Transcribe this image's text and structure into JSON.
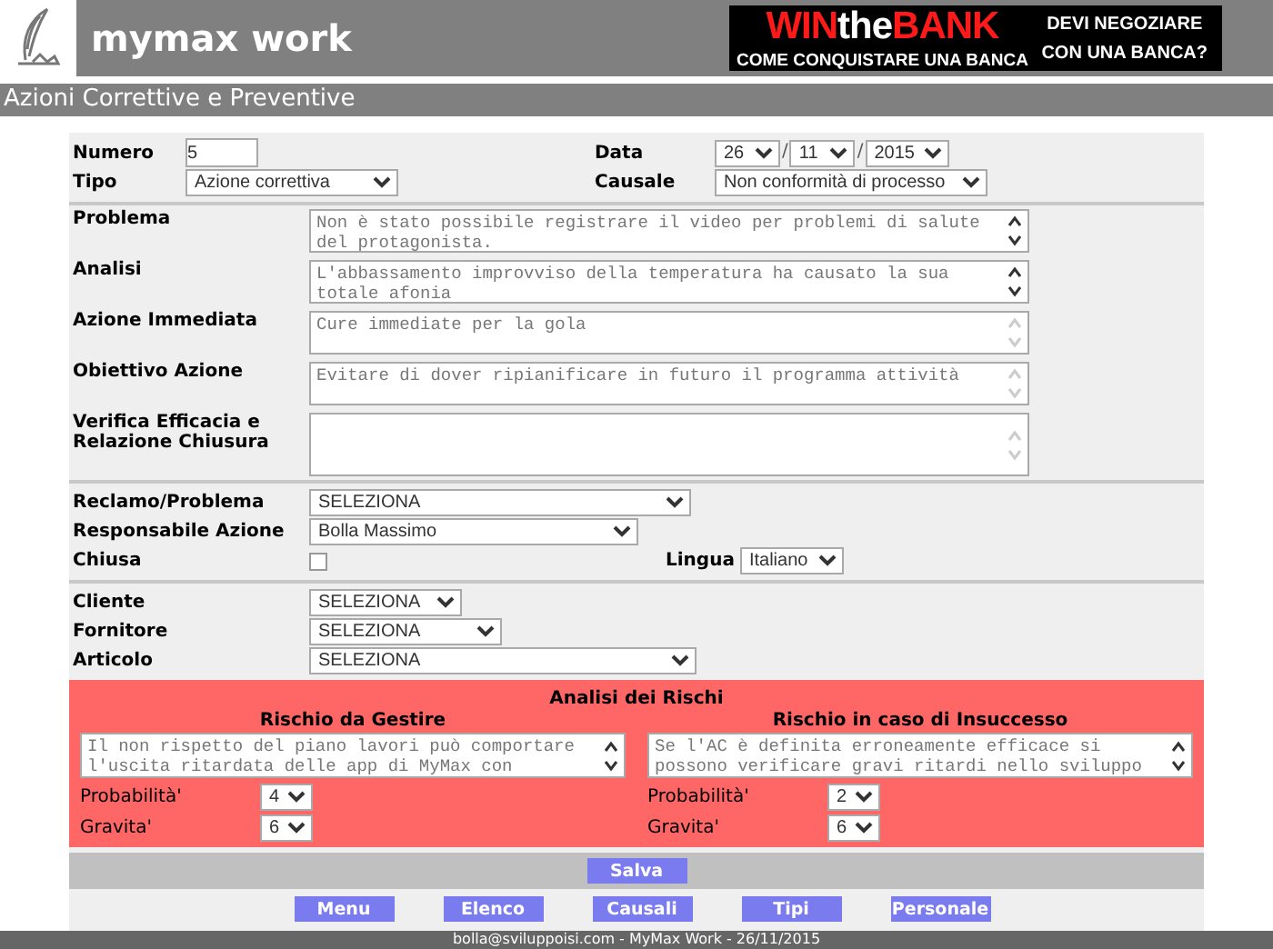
{
  "header": {
    "app_name": "mymax work",
    "banner": {
      "headline": [
        {
          "text": "WIN",
          "color": "#ff1a1a"
        },
        {
          "text": "the",
          "color": "#ffffff"
        },
        {
          "text": "BANK",
          "color": "#ff1a1a"
        }
      ],
      "tagline": "COME CONQUISTARE UNA BANCA",
      "side_lines": [
        "DEVI NEGOZIARE",
        "CON UNA BANCA?"
      ]
    }
  },
  "page_title": "Azioni Correttive e Preventive",
  "form": {
    "numero": {
      "label": "Numero",
      "value": "5"
    },
    "data": {
      "label": "Data",
      "day": "26",
      "month": "11",
      "year": "2015",
      "separators": [
        "/",
        "/"
      ]
    },
    "tipo": {
      "label": "Tipo",
      "value": "Azione correttiva"
    },
    "causale": {
      "label": "Causale",
      "value": "Non conformità di processo"
    },
    "text_fields": [
      {
        "label": "Problema",
        "value": "Non è stato possibile registrare il video per problemi di salute del protagonista.",
        "scrollable": true
      },
      {
        "label": "Analisi",
        "value": "L'abbassamento improvviso della temperatura ha causato la sua totale afonia",
        "scrollable": true
      },
      {
        "label": "Azione Immediata",
        "value": "Cure immediate per la gola",
        "scrollable": false
      },
      {
        "label": "Obiettivo Azione",
        "value": "Evitare di dover ripianificare in futuro il programma attività",
        "scrollable": false
      },
      {
        "label": "Verifica Efficacia e Relazione Chiusura",
        "scrollable": false,
        "tall": true
      }
    ],
    "reclamo": {
      "label": "Reclamo/Problema",
      "value": "SELEZIONA"
    },
    "responsabile": {
      "label": "Responsabile Azione",
      "value": "Bolla Massimo"
    },
    "chiusa": {
      "label": "Chiusa",
      "checked": false
    },
    "lingua": {
      "label": "Lingua",
      "value": "Italiano"
    },
    "cliente": {
      "label": "Cliente",
      "value": "SELEZIONA"
    },
    "fornitore": {
      "label": "Fornitore",
      "value": "SELEZIONA"
    },
    "articolo": {
      "label": "Articolo",
      "value": "SELEZIONA"
    }
  },
  "risk_analysis": {
    "title": "Analisi dei Rischi",
    "columns": [
      {
        "heading": "Rischio da Gestire",
        "text": "Il non rispetto del piano lavori può comportare l'uscita ritardata delle app di MyMax con",
        "probabilita": {
          "label": "Probabilità'",
          "value": "4"
        },
        "gravita": {
          "label": "Gravita'",
          "value": "6"
        }
      },
      {
        "heading": "Rischio in caso di Insuccesso",
        "text": "Se l'AC è definita erroneamente efficace si possono verificare gravi ritardi nello sviluppo",
        "probabilita": {
          "label": "Probabilità'",
          "value": "2"
        },
        "gravita": {
          "label": "Gravita'",
          "value": "6"
        }
      }
    ]
  },
  "save_button": "Salva",
  "nav_buttons": [
    "Menu",
    "Elenco",
    "Causali",
    "Tipi",
    "Personale"
  ],
  "footer": "bolla@sviluppoisi.com - MyMax Work - 26/11/2015"
}
